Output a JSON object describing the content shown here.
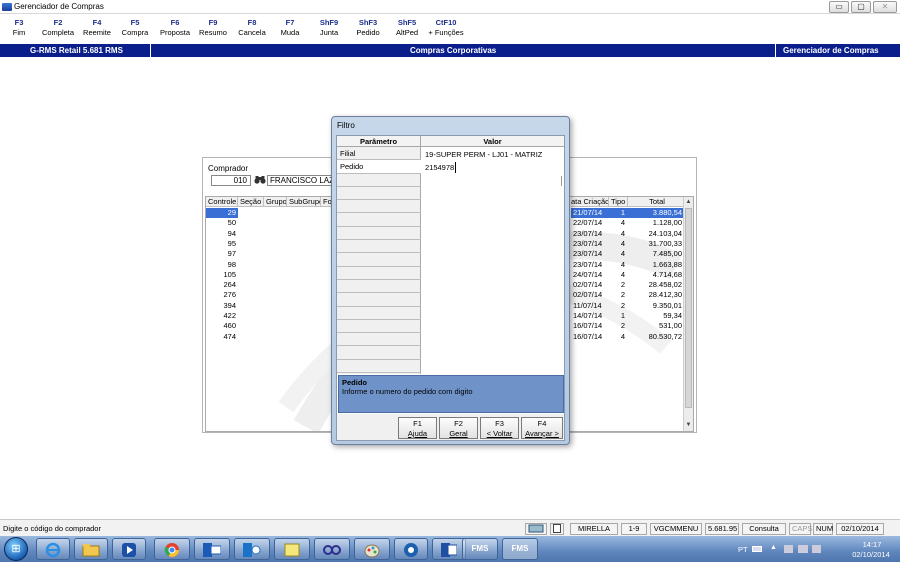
{
  "window": {
    "title": "Gerenciador de Compras",
    "btn_min": "▭",
    "btn_max": "▢",
    "btn_close": "✕"
  },
  "fkeys": [
    {
      "key": "F3",
      "label": "Fim"
    },
    {
      "key": "F2",
      "label": "Completa"
    },
    {
      "key": "F4",
      "label": "Reemite"
    },
    {
      "key": "F5",
      "label": "Compra"
    },
    {
      "key": "F6",
      "label": "Proposta"
    },
    {
      "key": "F9",
      "label": "Resumo"
    },
    {
      "key": "F8",
      "label": "Cancela"
    },
    {
      "key": "F7",
      "label": "Muda"
    },
    {
      "key": "ShF9",
      "label": "Junta"
    },
    {
      "key": "ShF3",
      "label": "Pedido"
    },
    {
      "key": "ShF5",
      "label": "AltPed"
    },
    {
      "key": "CtF10",
      "label": "+ Funções"
    }
  ],
  "header": {
    "left": "G-RMS Retail 5.681 RMS",
    "center": "Compras Corporativas",
    "right": "Gerenciador de Compras"
  },
  "comprador": {
    "label": "Comprador",
    "code": "010",
    "name": "FRANCISCO LAZARO"
  },
  "grid": {
    "headers_left": [
      "Controle",
      "Seção",
      "Grupo",
      "SubGrupo",
      "For"
    ],
    "headers_right": [
      "ata Criação",
      "Tipo",
      "Total"
    ],
    "rows": [
      {
        "controle": "29",
        "data": "21/07/14",
        "tipo": "1",
        "total": "3.880,54"
      },
      {
        "controle": "50",
        "data": "22/07/14",
        "tipo": "4",
        "total": "1.128,00"
      },
      {
        "controle": "94",
        "data": "23/07/14",
        "tipo": "4",
        "total": "24.103,04"
      },
      {
        "controle": "95",
        "data": "23/07/14",
        "tipo": "4",
        "total": "31.700,33"
      },
      {
        "controle": "97",
        "data": "23/07/14",
        "tipo": "4",
        "total": "7.485,00"
      },
      {
        "controle": "98",
        "data": "23/07/14",
        "tipo": "4",
        "total": "1.663,88"
      },
      {
        "controle": "105",
        "data": "24/07/14",
        "tipo": "4",
        "total": "4.714,68"
      },
      {
        "controle": "264",
        "data": "02/07/14",
        "tipo": "2",
        "total": "28.458,02"
      },
      {
        "controle": "276",
        "data": "02/07/14",
        "tipo": "2",
        "total": "28.412,30"
      },
      {
        "controle": "394",
        "data": "11/07/14",
        "tipo": "2",
        "total": "9.350,01"
      },
      {
        "controle": "422",
        "data": "14/07/14",
        "tipo": "1",
        "total": "59,34"
      },
      {
        "controle": "460",
        "data": "16/07/14",
        "tipo": "2",
        "total": "531,00"
      },
      {
        "controle": "474",
        "data": "16/07/14",
        "tipo": "4",
        "total": "80.530,72"
      }
    ],
    "scroll_up": "▲",
    "scroll_down": "▼"
  },
  "filtro": {
    "title": "Filtro",
    "col_param": "Parâmetro",
    "col_valor": "Valor",
    "params": [
      {
        "name": "Filial",
        "value": "19-SUPER PERM - LJ01 - MATRIZ"
      },
      {
        "name": "Pedido",
        "value": "2154978"
      }
    ],
    "desc_title": "Pedido",
    "desc_text": "Informe o numero do pedido com digito",
    "buttons": [
      {
        "key": "F1",
        "label": "Ajuda"
      },
      {
        "key": "F2",
        "label": "Geral"
      },
      {
        "key": "F3",
        "label": "< Voltar"
      },
      {
        "key": "F4",
        "label": "Avançar >"
      }
    ]
  },
  "status": {
    "hint": "Digite o código do comprador",
    "user": "MIRELLA",
    "page": "1-9",
    "menu": "VGCMMENU",
    "version": "5.681.95",
    "mode": "Consulta",
    "caps": "CAPS",
    "num": "NUM",
    "date": "02/10/2014"
  },
  "taskbar": {
    "start": "⊞",
    "fms1": "FMS",
    "fms2": "FMS",
    "lang": "PT",
    "time": "14:17",
    "date": "02/10/2014"
  }
}
